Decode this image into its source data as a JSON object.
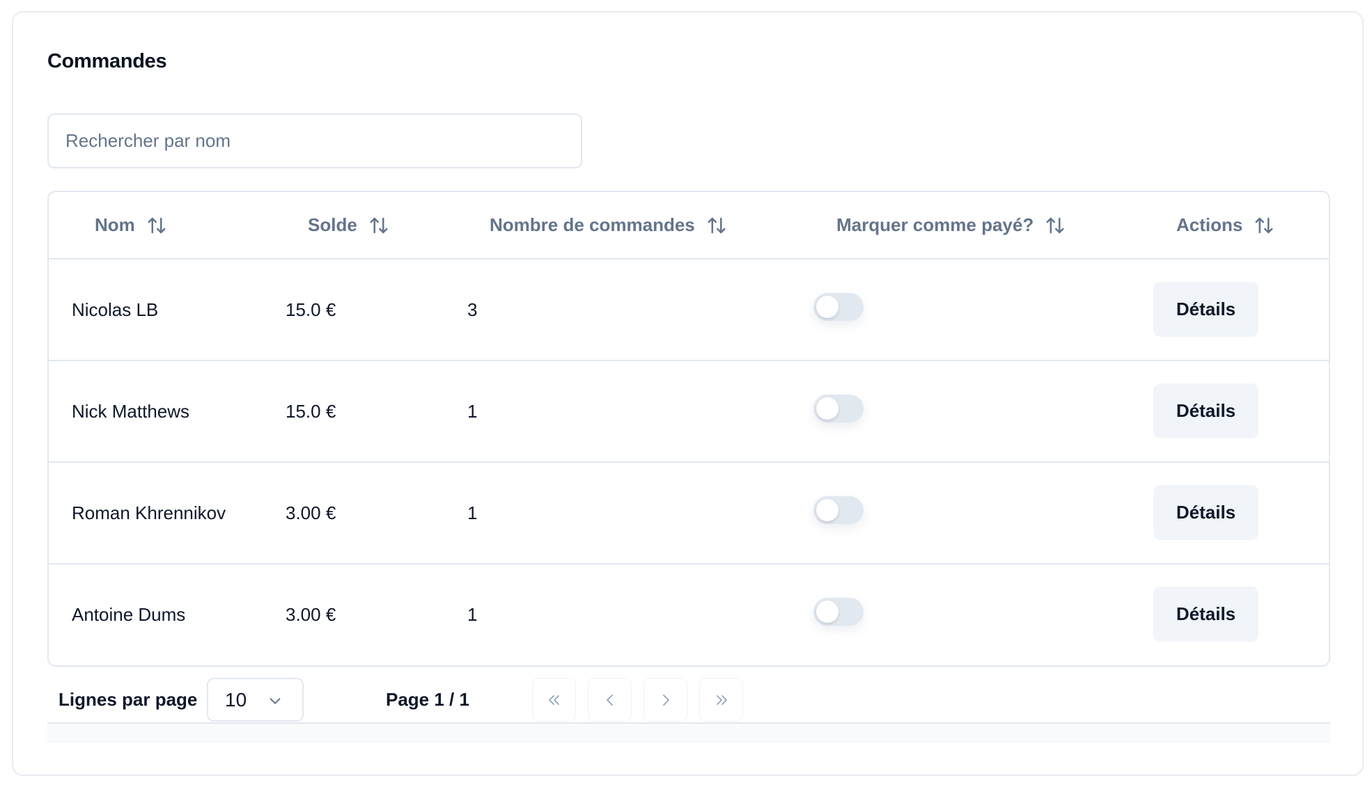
{
  "page": {
    "title": "Commandes"
  },
  "search": {
    "placeholder": "Rechercher par nom",
    "value": ""
  },
  "table": {
    "columns": [
      {
        "label": "Nom",
        "sort_icon": "sort-arrows-icon"
      },
      {
        "label": "Solde",
        "sort_icon": "sort-arrows-icon"
      },
      {
        "label": "Nombre de commandes",
        "sort_icon": "sort-arrows-icon"
      },
      {
        "label": "Marquer comme payé?",
        "sort_icon": "sort-arrows-icon"
      },
      {
        "label": "Actions",
        "sort_icon": "sort-arrows-icon"
      }
    ],
    "rows": [
      {
        "name": "Nicolas LB",
        "balance": "15.0 €",
        "order_count": "3",
        "paid": false,
        "action_label": "Détails"
      },
      {
        "name": "Nick Matthews",
        "balance": "15.0 €",
        "order_count": "1",
        "paid": false,
        "action_label": "Détails"
      },
      {
        "name": "Roman Khrennikov",
        "balance": "3.00 €",
        "order_count": "1",
        "paid": false,
        "action_label": "Détails"
      },
      {
        "name": "Antoine Dums",
        "balance": "3.00 €",
        "order_count": "1",
        "paid": false,
        "action_label": "Détails"
      }
    ]
  },
  "pagination": {
    "rows_per_page_label": "Lignes par page",
    "rows_per_page_value": "10",
    "page_info": "Page 1 / 1",
    "buttons": [
      {
        "name": "first-page",
        "icon": "chevrons-left-icon"
      },
      {
        "name": "previous-page",
        "icon": "chevron-left-icon"
      },
      {
        "name": "next-page",
        "icon": "chevron-right-icon"
      },
      {
        "name": "last-page",
        "icon": "chevrons-right-icon"
      }
    ]
  },
  "colors": {
    "text_primary": "#0f172a",
    "text_muted": "#64748b",
    "border": "#e2e8f0",
    "button_bg": "#f1f5f9",
    "toggle_off": "#e2e8f0"
  }
}
